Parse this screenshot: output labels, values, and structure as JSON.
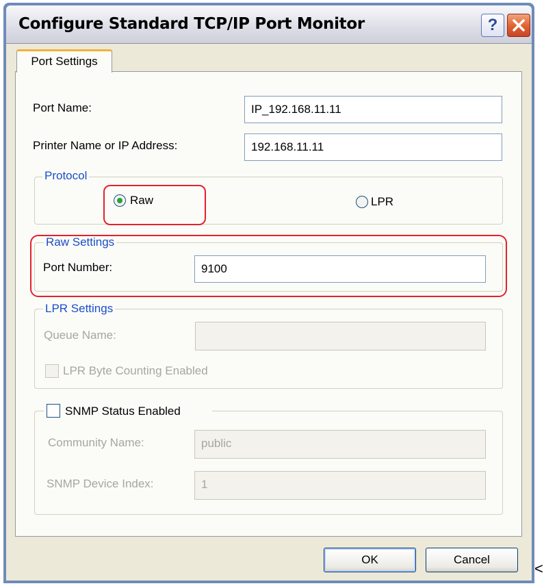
{
  "window": {
    "title": "Configure Standard TCP/IP Port Monitor",
    "help_label": "?"
  },
  "tabs": [
    {
      "label": "Port Settings"
    }
  ],
  "port_name": {
    "label": "Port Name:",
    "value": "IP_192.168.11.11"
  },
  "printer_address": {
    "label": "Printer Name or IP Address:",
    "value": "192.168.11.11"
  },
  "protocol": {
    "legend": "Protocol",
    "options": [
      {
        "label": "Raw",
        "selected": true
      },
      {
        "label": "LPR",
        "selected": false
      }
    ]
  },
  "raw_settings": {
    "legend": "Raw Settings",
    "port_number_label": "Port Number:",
    "port_number_value": "9100"
  },
  "lpr_settings": {
    "legend": "LPR Settings",
    "queue_name_label": "Queue Name:",
    "queue_name_value": "",
    "byte_counting_label": "LPR Byte Counting Enabled",
    "byte_counting_checked": false
  },
  "snmp": {
    "enabled_label": "SNMP Status Enabled",
    "enabled_checked": false,
    "community_label": "Community Name:",
    "community_value": "public",
    "device_index_label": "SNMP Device Index:",
    "device_index_value": "1"
  },
  "buttons": {
    "ok": "OK",
    "cancel": "Cancel"
  },
  "stray_char": "<",
  "colors": {
    "highlight": "#e4202a",
    "legend": "#1a4ec9",
    "tab_accent": "#f2b23a",
    "close_button": "#e0602f"
  }
}
